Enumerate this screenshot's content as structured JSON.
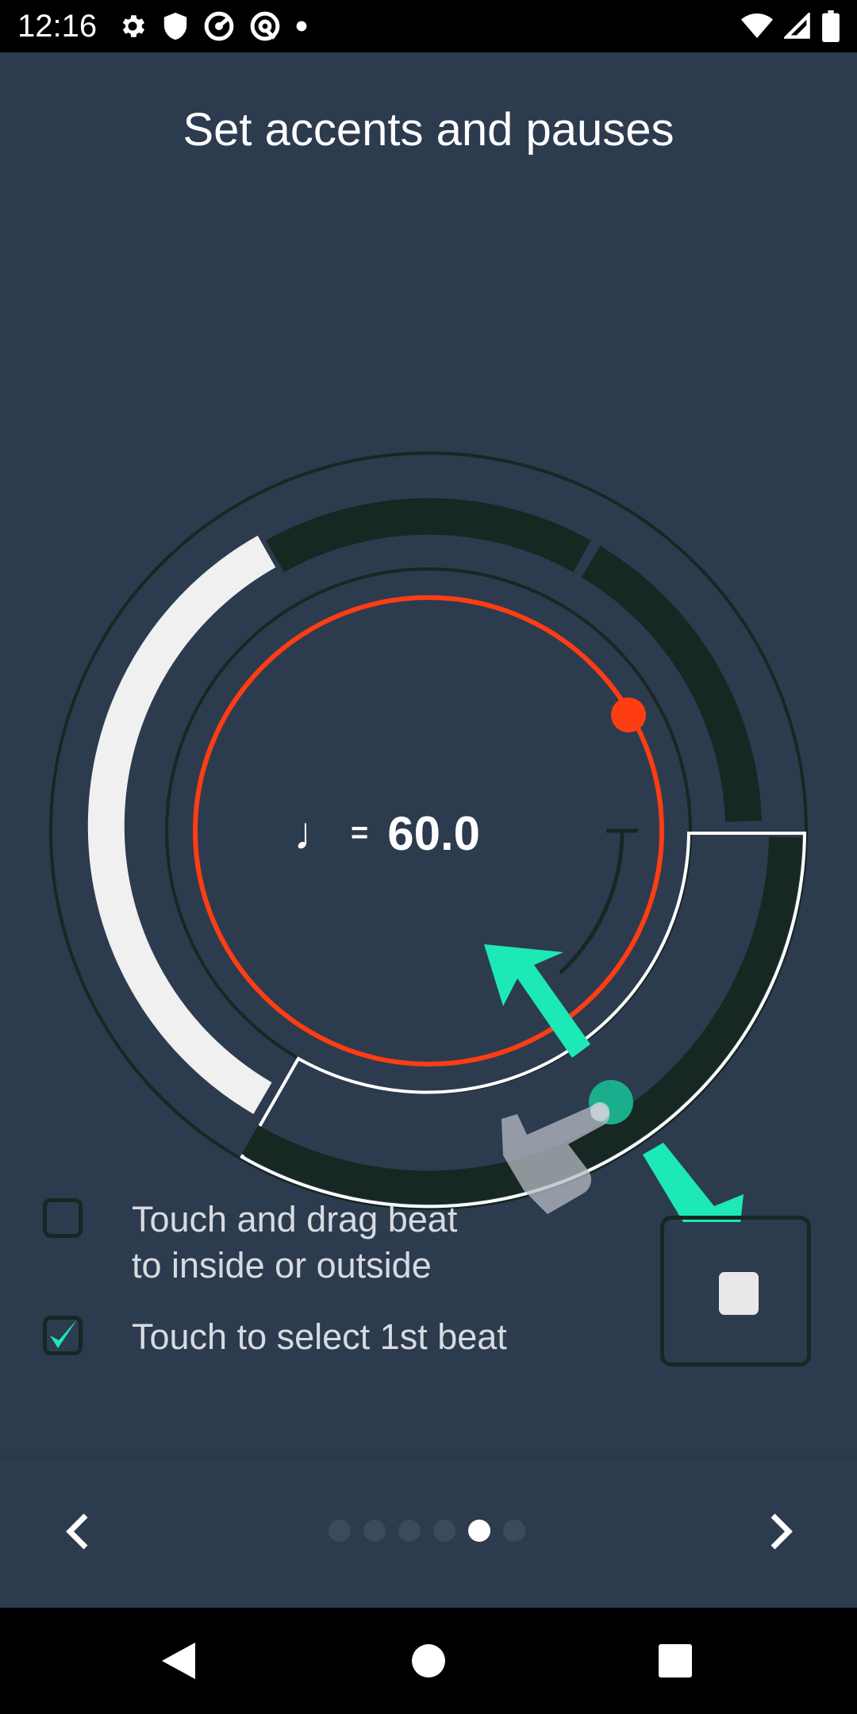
{
  "status_bar": {
    "time": "12:16",
    "left_icons": [
      "gear-icon",
      "shield-icon",
      "speedometer-icon",
      "at-sign-icon",
      "dot-icon"
    ],
    "right_icons": [
      "wifi-icon",
      "cell-signal-icon",
      "battery-icon"
    ]
  },
  "tutorial": {
    "title": "Set accents and pauses",
    "tempo": {
      "note_symbol": "♩",
      "equals": "=",
      "value": "60.0"
    },
    "tips": [
      {
        "text": "Touch and drag beat\nto inside or outside",
        "checked": false
      },
      {
        "text": "Touch to select 1st beat",
        "checked": true
      }
    ]
  },
  "pager": {
    "total_pages": 6,
    "current_page": 5
  },
  "colors": {
    "background": "#2d3b4f",
    "accent_teal": "#1de9b6",
    "ring_red": "#ff3d12",
    "beat_dark": "#172722",
    "beat_light": "#f0f0f0"
  }
}
